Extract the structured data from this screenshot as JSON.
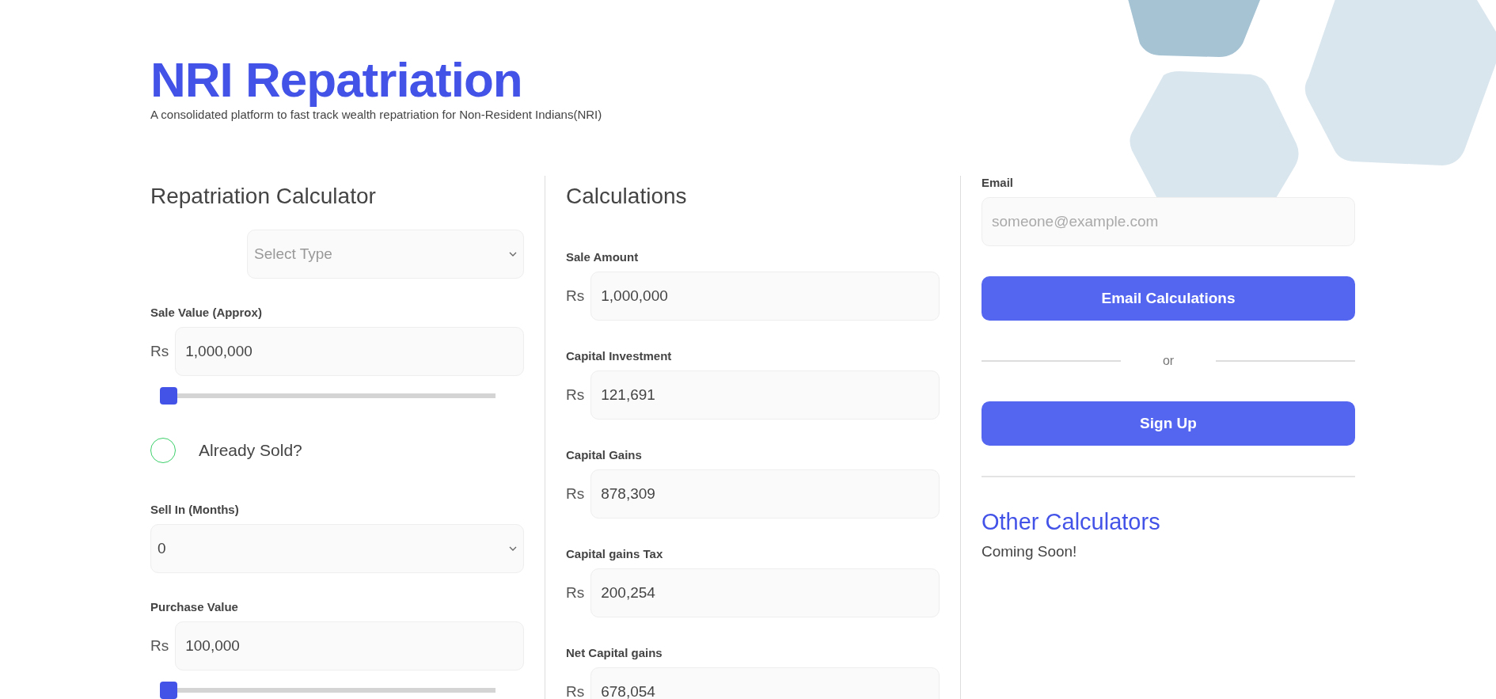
{
  "header": {
    "title": "NRI Repatriation",
    "subtitle": "A consolidated platform to fast track wealth repatriation for Non-Resident Indians(NRI)"
  },
  "calculator": {
    "heading": "Repatriation Calculator",
    "type_select": {
      "placeholder": "Select Type"
    },
    "fields": [
      {
        "kind": "money",
        "label": "Sale Value (Approx)",
        "prefix": "Rs",
        "value": "1,000,000",
        "level": 0
      },
      {
        "kind": "checkbox",
        "label": "Already Sold?",
        "checked": false
      },
      {
        "kind": "select",
        "label": "Sell In (Months)",
        "value": "0"
      },
      {
        "kind": "money",
        "label": "Purchase Value",
        "prefix": "Rs",
        "value": "100,000",
        "level": 0
      }
    ]
  },
  "calculations": {
    "heading": "Calculations",
    "rows": [
      {
        "label": "Sale Amount",
        "prefix": "Rs",
        "value": "1,000,000"
      },
      {
        "label": "Capital Investment",
        "prefix": "Rs",
        "value": "121,691"
      },
      {
        "label": "Capital Gains",
        "prefix": "Rs",
        "value": "878,309"
      },
      {
        "label": "Capital gains Tax",
        "prefix": "Rs",
        "value": "200,254"
      },
      {
        "label": "Net Capital gains",
        "prefix": "Rs",
        "value": "678,054"
      }
    ]
  },
  "sidebar": {
    "email_label": "Email",
    "email_placeholder": "someone@example.com",
    "email_button": "Email Calculations",
    "separator": "or",
    "signup_button": "Sign Up",
    "other_heading": "Other Calculators",
    "other_text": "Coming Soon!"
  }
}
